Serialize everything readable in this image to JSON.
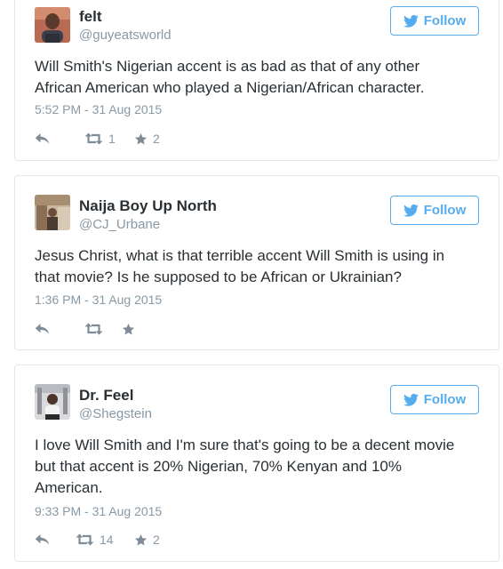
{
  "brand_color": "#55acee",
  "icons": {
    "follow": "twitter-bird-icon",
    "reply": "reply-icon",
    "retweet": "retweet-icon",
    "favorite": "star-icon"
  },
  "tweets": [
    {
      "name": "felt",
      "handle": "@guyeatsworld",
      "follow_label": "Follow",
      "text": "Will Smith's Nigerian accent is as bad as  that of any other African American who played a Nigerian/African character.",
      "timestamp": "5:52 PM - 31 Aug 2015",
      "retweets": "1",
      "favorites": "2"
    },
    {
      "name": "Naija Boy Up North",
      "handle": "@CJ_Urbane",
      "follow_label": "Follow",
      "text": "Jesus Christ, what is that terrible accent Will Smith is using in that movie? Is he supposed to be African or Ukrainian?",
      "timestamp": "1:36 PM - 31 Aug 2015",
      "retweets": "",
      "favorites": ""
    },
    {
      "name": "Dr. Feel",
      "handle": "@Shegstein",
      "follow_label": "Follow",
      "text": "I love Will Smith and I'm sure that's going to be a decent movie but that accent is 20% Nigerian, 70% Kenyan and 10% American.",
      "timestamp": "9:33 PM - 31 Aug 2015",
      "retweets": "14",
      "favorites": "2"
    }
  ]
}
